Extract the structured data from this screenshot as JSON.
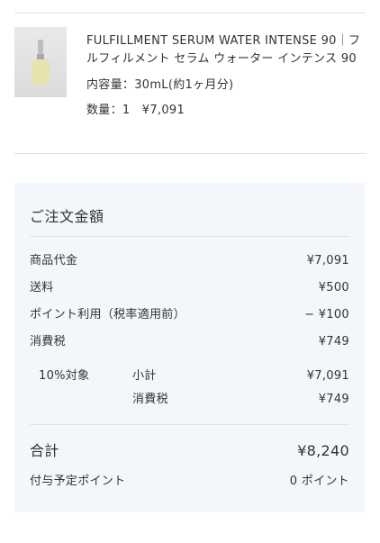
{
  "product": {
    "name": "FULFILLMENT SERUM WATER INTENSE 90｜フルフィルメント セラム ウォーター インテンス 90",
    "volume": "内容量：30mL(約1ヶ月分)",
    "quantity_price": "数量：1　¥7,091",
    "image_icon": "serum-bottle-image"
  },
  "summary": {
    "title": "ご注文金額",
    "subtotal_label": "商品代金",
    "subtotal_value": "¥7,091",
    "shipping_label": "送料",
    "shipping_value": "¥500",
    "points_label": "ポイント利用（税率適用前）",
    "points_value": "− ¥100",
    "tax_label": "消費税",
    "tax_value": "¥749",
    "breakdown": {
      "target_label": "10%対象",
      "sub_label": "小計",
      "sub_value": "¥7,091",
      "tax_label": "消費税",
      "tax_value": "¥749"
    },
    "total_label": "合計",
    "total_value": "¥8,240",
    "earn_label": "付与予定ポイント",
    "earn_value": "0 ポイント"
  },
  "colors": {
    "summary_background": "#f3f6fa",
    "divider": "#e2e2e2",
    "text": "#333333"
  }
}
